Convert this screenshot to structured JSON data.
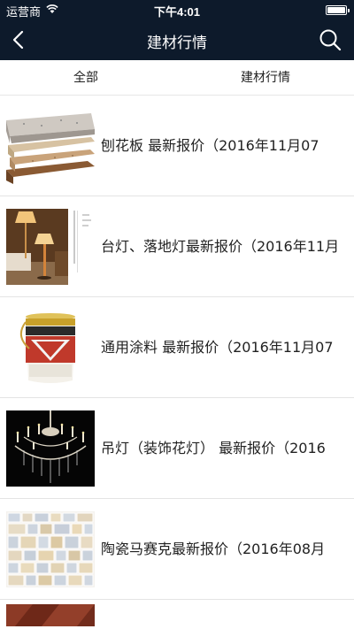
{
  "status": {
    "carrier": "运营商",
    "time": "下午4:01"
  },
  "nav": {
    "title": "建材行情",
    "back_icon": "chevron-left-icon",
    "search_icon": "search-icon"
  },
  "tabs": [
    {
      "label": "全部"
    },
    {
      "label": "建材行情"
    }
  ],
  "items": [
    {
      "title": "刨花板 最新报价（2016年11月07",
      "thumb": "particleboard"
    },
    {
      "title": "台灯、落地灯最新报价（2016年11月",
      "thumb": "lamps"
    },
    {
      "title": "通用涂料 最新报价（2016年11月07",
      "thumb": "paint-bucket"
    },
    {
      "title": "吊灯（装饰花灯） 最新报价（2016",
      "thumb": "chandelier"
    },
    {
      "title": "陶瓷马赛克最新报价（2016年08月",
      "thumb": "mosaic"
    },
    {
      "title": "",
      "thumb": "wood-floor"
    }
  ],
  "colors": {
    "header_bg": "#0d1a2b",
    "divider": "#e4e4e4"
  }
}
